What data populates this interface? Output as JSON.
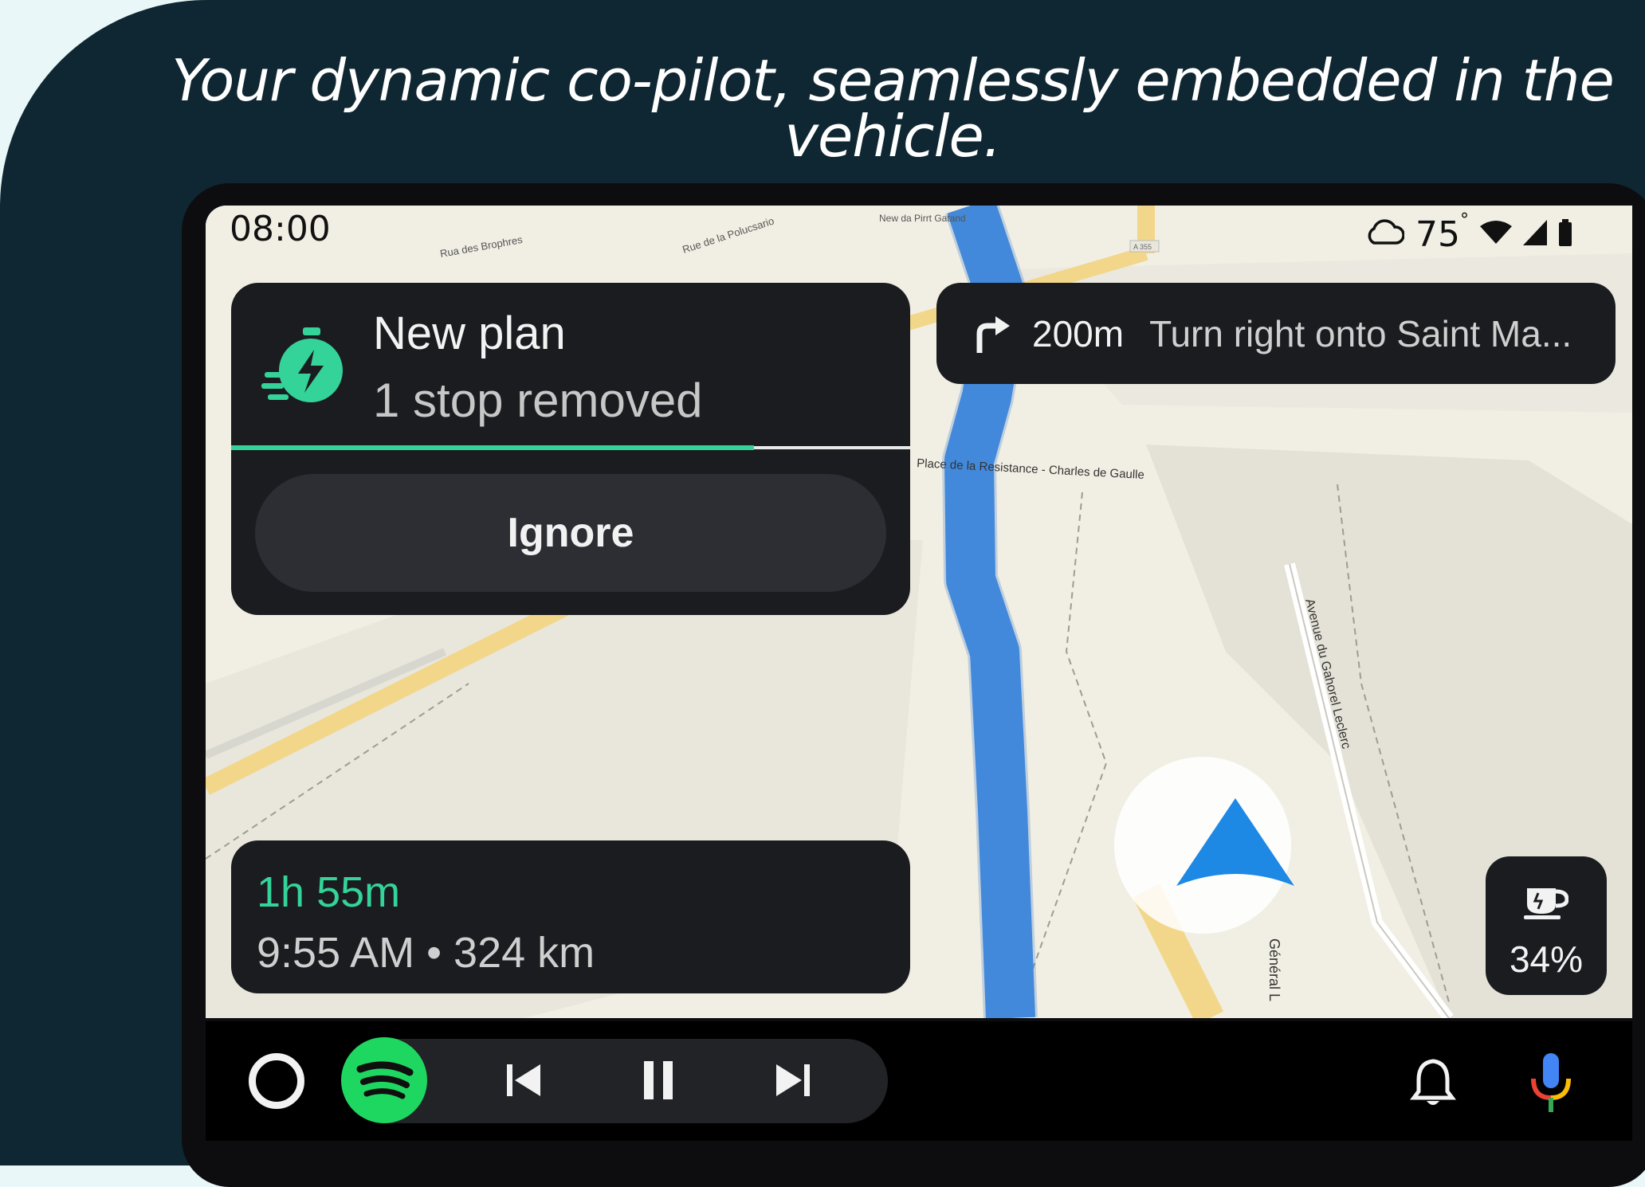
{
  "tagline": "Your dynamic co-pilot, seamlessly embedded in the vehicle.",
  "status_bar": {
    "time": "08:00",
    "temperature": "75",
    "degree_symbol": "°",
    "icons": [
      "cloud-icon",
      "wifi-icon",
      "signal-icon",
      "battery-icon"
    ]
  },
  "map_labels": {
    "street_1": "Rua des Brophres",
    "street_2": "Rue de la Polucsario",
    "street_3": "New da Pirrt Gatand",
    "shield": "A 355",
    "place": "Place de la Resistance - Charles de Gaulle",
    "avenue": "Avenue du Gahorel Leclerc",
    "general": "Général L"
  },
  "plan_card": {
    "title": "New plan",
    "subtitle": "1 stop removed",
    "progress_fraction": 0.77,
    "button_label": "Ignore",
    "icon": "stopwatch-lightning-icon",
    "accent_color": "#34d399"
  },
  "turn_card": {
    "distance": "200m",
    "instruction": "Turn right onto Saint Ma...",
    "icon": "turn-right-icon"
  },
  "eta_card": {
    "duration": "1h 55m",
    "arrival_and_distance": "9:55 AM • 324 km"
  },
  "battery_card": {
    "percent": "34%",
    "icon": "coffee-cup-icon"
  },
  "dock": {
    "icons": [
      "home-icon",
      "spotify-icon",
      "previous-track-icon",
      "pause-icon",
      "next-track-icon",
      "bell-icon",
      "microphone-icon"
    ]
  },
  "colors": {
    "background": "#0f2732",
    "route": "#4a90e2",
    "card": "#1b1c20",
    "spotify": "#1ed760"
  }
}
